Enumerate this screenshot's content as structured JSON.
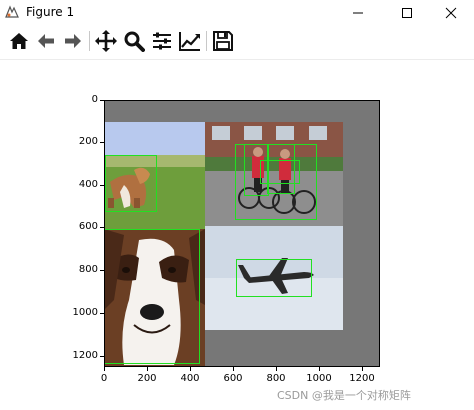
{
  "window": {
    "title": "Figure 1",
    "controls": [
      "minimize",
      "maximize",
      "close"
    ]
  },
  "toolbar": {
    "buttons": [
      {
        "name": "home-icon",
        "label": "Home"
      },
      {
        "name": "back-icon",
        "label": "Back"
      },
      {
        "name": "forward-icon",
        "label": "Forward"
      },
      {
        "name": "pan-icon",
        "label": "Pan"
      },
      {
        "name": "zoom-icon",
        "label": "Zoom"
      },
      {
        "name": "subplots-icon",
        "label": "Configure subplots"
      },
      {
        "name": "edit-axis-icon",
        "label": "Edit axis"
      },
      {
        "name": "save-icon",
        "label": "Save"
      }
    ]
  },
  "plot": {
    "y_ticks": [
      "0",
      "200",
      "400",
      "600",
      "800",
      "1000",
      "1200"
    ],
    "x_ticks": [
      "0",
      "200",
      "400",
      "600",
      "800",
      "1000",
      "1200"
    ],
    "background_color": "#777777",
    "box_color": "#22e022",
    "panels": [
      "dog on grass",
      "two cyclists",
      "Saint Bernard dog",
      "airplane in sky"
    ]
  },
  "watermark": "CSDN @我是一个对称矩阵"
}
